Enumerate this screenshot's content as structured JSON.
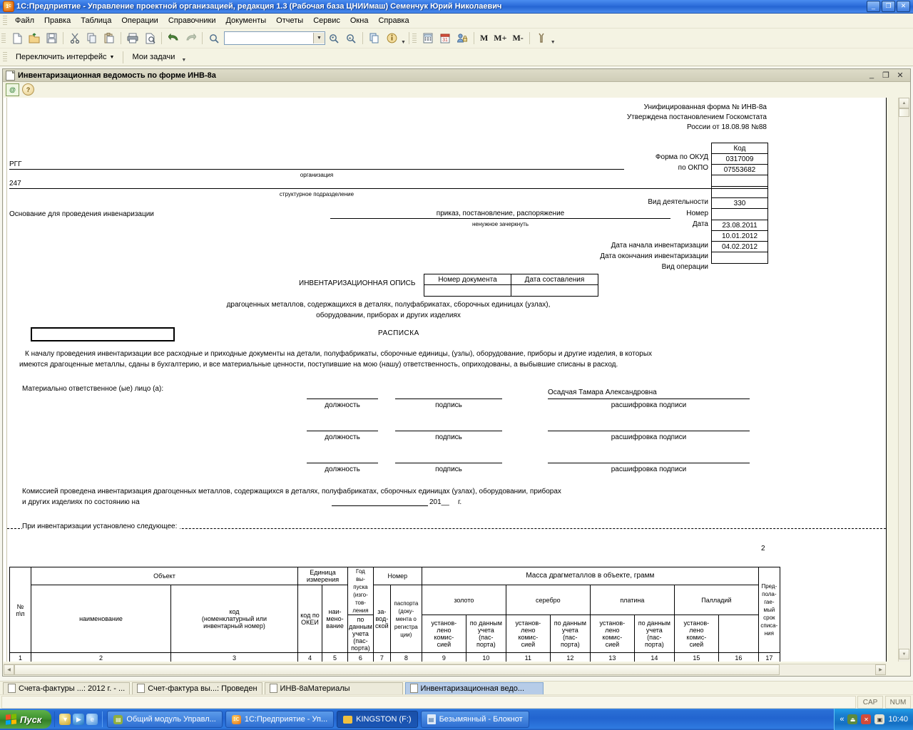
{
  "window": {
    "title": "1С:Предприятие - Управление проектной организацией, редакция 1.3 (Рабочая база ЦНИИмаш) Семенчук Юрий Николаевич",
    "minimize": "_",
    "maximize": "❐",
    "close": "✕"
  },
  "menu": [
    "Файл",
    "Правка",
    "Таблица",
    "Операции",
    "Справочники",
    "Документы",
    "Отчеты",
    "Сервис",
    "Окна",
    "Справка"
  ],
  "toolbar": {
    "search_value": "",
    "m_buttons": [
      "M",
      "M+",
      "M-"
    ]
  },
  "toolbar2": {
    "switch_interface": "Переключить интерфейс",
    "my_tasks": "Мои задачи"
  },
  "mdi": {
    "title": "Инвентаризационная ведомость по форме ИНВ-8а",
    "minimize": "_",
    "restore": "❐",
    "close": "✕"
  },
  "doc": {
    "header_lines": [
      "Унифицированная форма № ИНВ-8а",
      "Утверждена постановлением Госкомстата",
      "России от 18.08.98 №88"
    ],
    "code_table": {
      "header": "Код",
      "rows": [
        {
          "label": "Форма по ОКУД",
          "value": "0317009"
        },
        {
          "label": "по ОКПО",
          "value": "07553682"
        },
        {
          "label": "",
          "value": ""
        },
        {
          "label": "Вид деятельности",
          "value": ""
        },
        {
          "label": "Номер",
          "value": "330"
        },
        {
          "label": "Дата",
          "value": ""
        },
        {
          "label": "",
          "value": "23.08.2011"
        },
        {
          "label": "Дата начала инвентаризации",
          "value": "10.01.2012"
        },
        {
          "label": "Дата окончания инвентаризации",
          "value": "04.02.2012"
        },
        {
          "label": "Вид операции",
          "value": ""
        }
      ]
    },
    "organization_value": "РГГ",
    "organization_caption": "организация",
    "subdivision_value": "247",
    "subdivision_caption": "структурное подразделение",
    "basis_label": "Основание для проведения инвенаризации",
    "basis_options": "приказ,   постановление,   распоряжение",
    "basis_hint": "ненужное зачеркнуть",
    "opis_title": "ИНВЕНТАРИЗАЦИОННАЯ ОПИСЬ",
    "opis_doc_num_header": "Номер документа",
    "opis_doc_date_header": "Дата составления",
    "opis_doc_num_value": "",
    "opis_doc_date_value": "",
    "opis_sub1": "драгоценных металлов, содержащихся в деталях, полуфабрикатах, сборочных единицах (узлах),",
    "opis_sub2": "оборудовании, приборах и других изделиях",
    "raspiska": "РАСПИСКА",
    "body1": "К началу проведения инвентаризации все расходные и приходные документы на детали, полуфабрикаты, сборочные единицы, (узлы), оборудование, приборы и другие изделия, в которых",
    "body2": "имеются   драгоценные металлы, сданы в бухгалтерию, и все материальные ценности, поступившие на мою (нашу) ответственность, оприходованы, а выбывшие списаны в расход.",
    "mol_label": "Материально ответственное (ые) лицо (а):",
    "signature_rows": [
      {
        "name": "Осадчая Тамара Александровна",
        "c1": "должность",
        "c2": "подпись",
        "c3": "расшифровка подписи"
      },
      {
        "name": "",
        "c1": "должность",
        "c2": "подпись",
        "c3": "расшифровка подписи"
      },
      {
        "name": "",
        "c1": "должность",
        "c2": "подпись",
        "c3": "расшифровка подписи"
      }
    ],
    "commission1": "Комиссией проведена инвентаризация драгоценных металлов, содержащихся в деталях, полуфабрикатах, сборочных единицах (узлах), оборудовании, приборах",
    "commission2": "и других изделиях по состоянию на",
    "commission_year": "201__",
    "commission_g": "г.",
    "found_label": "При инвентаризации установлено следующее:",
    "page_number": "2"
  },
  "table": {
    "group_object": "Объект",
    "group_unit": "Единица\nизмерения",
    "group_number": "Номер",
    "group_mass": "Масса драгметаллов в объекте, грамм",
    "metals": [
      "золото",
      "серебро",
      "платина",
      "Палладий"
    ],
    "metal_sub": [
      "по данным\nучета\n(пас-\nпорта)",
      "установ-\nлено\nкомис-\nсией"
    ],
    "col_np": "№\nп\\п",
    "col_name": "наименование",
    "col_code": "код\n(номенклатурный или\nинвентарный номер)",
    "col_okei": "код по\nОКЕИ",
    "col_unitname": "наи-\nмено-\nвание",
    "col_year": "Год\nвы-\nпуска\n(изго-\nтов-\nления",
    "col_factory": "за-\nвод-\nской",
    "col_passport": "паспорта\n(доку-\nмента о\nрегистра\nции)",
    "col_lastcol": "Пред-\nпола-\nгае-\nмый\nсрок\nсписа-\nния",
    "numbers": [
      "1",
      "2",
      "3",
      "4",
      "5",
      "6",
      "7",
      "8",
      "9",
      "10",
      "11",
      "12",
      "13",
      "14",
      "15",
      "16",
      "17"
    ]
  },
  "winlist": [
    {
      "label": "Счета-фактуры ...: 2012 г. - ...",
      "active": false
    },
    {
      "label": "Счет-фактура вы...: Проведен",
      "active": false
    },
    {
      "label": "ИНВ-8аМатериалы",
      "active": false
    },
    {
      "label": "Инвентаризационная ведо...",
      "active": true
    }
  ],
  "statusbar": {
    "cap": "CAP",
    "num": "NUM"
  },
  "taskbar": {
    "start": "Пуск",
    "items": [
      {
        "label": "Общий модуль Управл...",
        "active": false,
        "icon_color": "#8fae3f"
      },
      {
        "label": "1С:Предприятие - Уп...",
        "active": false,
        "icon_color": "#e06b12"
      },
      {
        "label": "KINGSTON (F:)",
        "active": true,
        "icon_color": "#f0c040"
      },
      {
        "label": "Безымянный - Блокнот",
        "active": false,
        "icon_color": "#8fb8e8"
      }
    ],
    "clock": "10:40",
    "tray_expand": "«"
  },
  "colors": {
    "title_blue": "#2a6ad8",
    "panel": "#f4f3e3",
    "active_tab": "#b6cce8",
    "taskbar_blue": "#2264cf",
    "start_green": "#3f9330"
  }
}
